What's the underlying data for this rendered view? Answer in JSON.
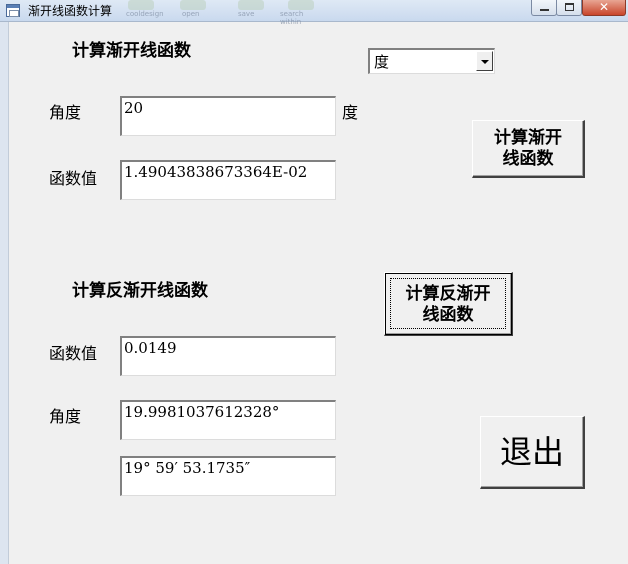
{
  "window": {
    "title": "渐开线函数计算",
    "toolbar_ghost": [
      "cooldesign",
      "open",
      "save",
      "search within"
    ]
  },
  "section1": {
    "heading": "计算渐开线函数",
    "unit_select": {
      "selected": "度"
    },
    "angle_label": "角度",
    "angle_value": "20",
    "angle_unit": "度",
    "func_label": "函数值",
    "func_value": "1.49043838673364E-02",
    "compute_button": [
      "计算渐开",
      "线函数"
    ]
  },
  "section2": {
    "heading": "计算反渐开线函数",
    "func_label": "函数值",
    "func_value": "0.0149",
    "angle_label": "角度",
    "angle_decimal": "19.9981037612328°",
    "angle_dms": "19° 59′ 53.1735″",
    "compute_button": [
      "计算反渐开",
      "线函数"
    ]
  },
  "exit_button": "退出"
}
